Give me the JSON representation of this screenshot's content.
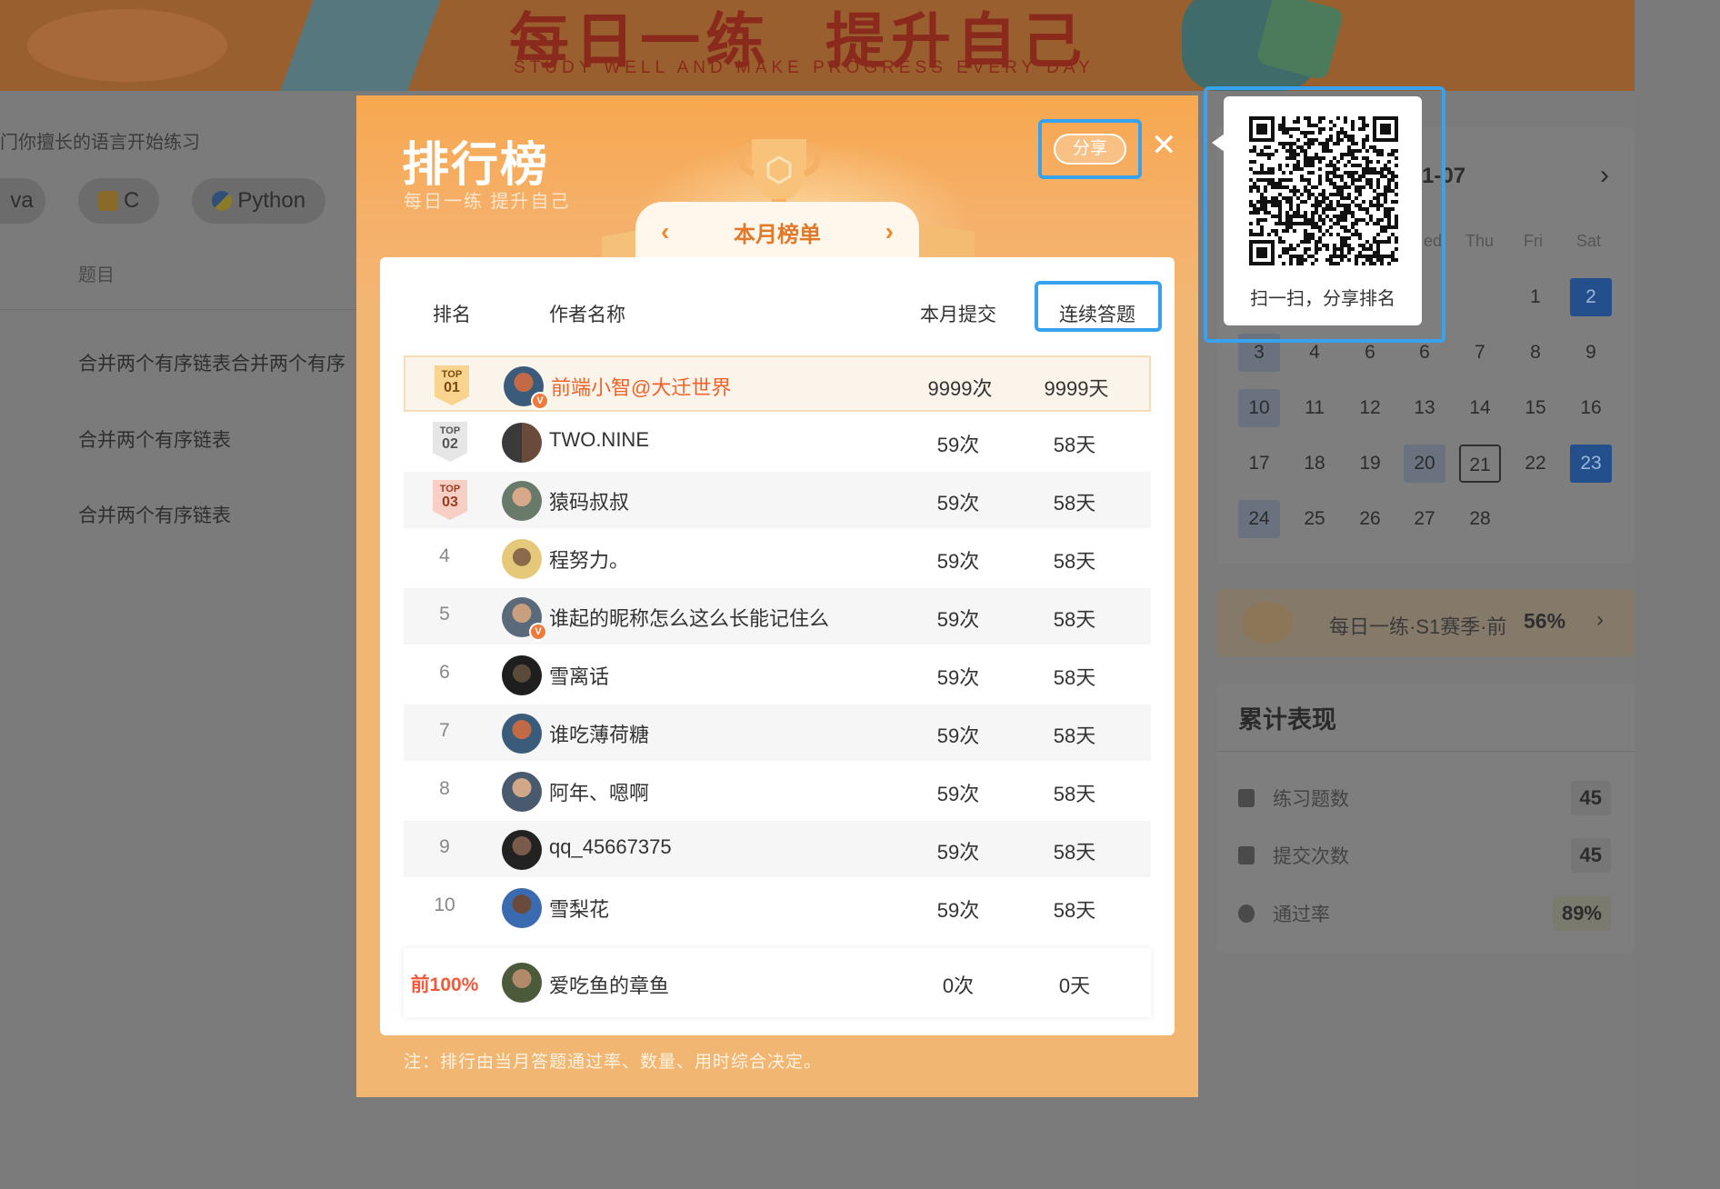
{
  "banner": {
    "title_left": "每日一练",
    "title_right": "提升自己",
    "subtitle": "STUDY WELL AND MAKE PROGRESS EVERY DAY"
  },
  "background": {
    "hint": "门你擅长的语言开始练习",
    "languages": [
      "va",
      "C",
      "Python"
    ],
    "column_label": "题目",
    "questions": [
      "合并两个有序链表合并两个有序",
      "合并两个有序链表",
      "合并两个有序链表"
    ]
  },
  "calendar": {
    "month_label": "1-07",
    "weekdays": [
      "ed",
      "Thu",
      "Fri",
      "Sat"
    ],
    "days": [
      "1",
      "2",
      "3",
      "4",
      "6",
      "6",
      "7",
      "8",
      "9",
      "10",
      "11",
      "12",
      "13",
      "14",
      "15",
      "16",
      "17",
      "18",
      "19",
      "20",
      "21",
      "22",
      "23",
      "24",
      "25",
      "26",
      "27",
      "28"
    ]
  },
  "season": {
    "label": "每日一练·S1赛季·前",
    "percent": "56%"
  },
  "stats": {
    "title": "累计表现",
    "items": [
      {
        "label": "练习题数",
        "value": "45"
      },
      {
        "label": "提交次数",
        "value": "45"
      },
      {
        "label": "通过率",
        "value": "89%"
      }
    ]
  },
  "modal": {
    "title": "排行榜",
    "subtitle": "每日一练 提升自己",
    "tab_label": "本月榜单",
    "share_label": "分享",
    "close_glyph": "✕",
    "prev_glyph": "‹",
    "next_glyph": "›",
    "columns": {
      "rank": "排名",
      "name": "作者名称",
      "submissions": "本月提交",
      "streak": "连续答题"
    },
    "rows": [
      {
        "rank": "01",
        "medal": "TOP",
        "name": "前端小智@大迁世界",
        "submissions": "9999次",
        "streak": "9999天"
      },
      {
        "rank": "02",
        "medal": "TOP",
        "name": "TWO.NINE",
        "submissions": "59次",
        "streak": "58天"
      },
      {
        "rank": "03",
        "medal": "TOP",
        "name": "猿码叔叔",
        "submissions": "59次",
        "streak": "58天"
      },
      {
        "rank": "4",
        "name": "程努力。",
        "submissions": "59次",
        "streak": "58天"
      },
      {
        "rank": "5",
        "name": "谁起的昵称怎么这么长能记住么",
        "submissions": "59次",
        "streak": "58天"
      },
      {
        "rank": "6",
        "name": "雪离话",
        "submissions": "59次",
        "streak": "58天"
      },
      {
        "rank": "7",
        "name": "谁吃薄荷糖",
        "submissions": "59次",
        "streak": "58天"
      },
      {
        "rank": "8",
        "name": "阿年、嗯啊",
        "submissions": "59次",
        "streak": "58天"
      },
      {
        "rank": "9",
        "name": "qq_45667375",
        "submissions": "59次",
        "streak": "58天"
      },
      {
        "rank": "10",
        "name": "雪梨花",
        "submissions": "59次",
        "streak": "58天"
      }
    ],
    "me": {
      "rank": "前100%",
      "name": "爱吃鱼的章鱼",
      "submissions": "0次",
      "streak": "0天"
    },
    "note": "注：排行由当月答题通过率、数量、用时综合决定。"
  },
  "qr": {
    "caption": "扫一扫，分享排名"
  },
  "colors": {
    "accent_orange": "#f0632a",
    "modal_bg": "#f2b673",
    "highlight_blue": "#36a2f0"
  }
}
